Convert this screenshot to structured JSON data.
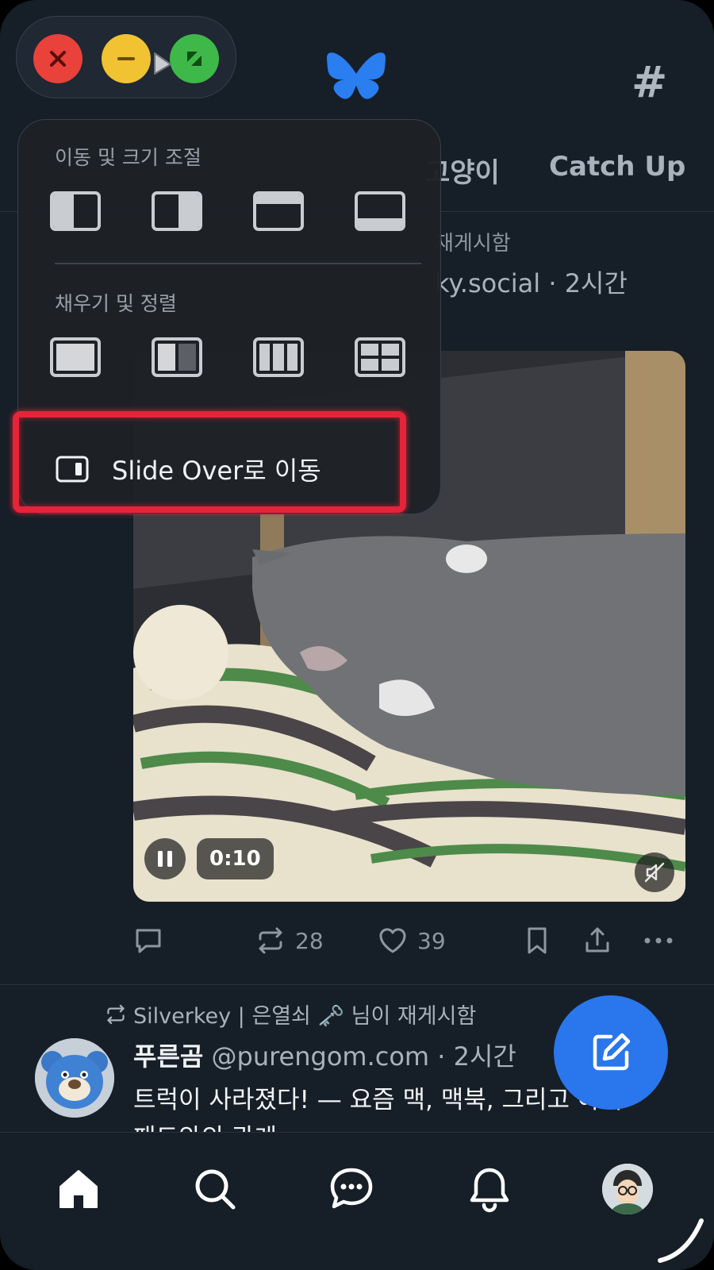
{
  "header": {
    "hash_label": "#",
    "tabs": [
      {
        "label": "고양이"
      },
      {
        "label": "Catch Up"
      }
    ]
  },
  "post1": {
    "repost_text_fragment": "재게시함",
    "author_fragment": "ky.social · 2시간",
    "video": {
      "time": "0:10",
      "playing": true,
      "muted": true
    },
    "actions": {
      "repost_count": "28",
      "like_count": "39"
    }
  },
  "post2": {
    "repost_by": "Silverkey | 은열쇠 🗝️ 님이 재게시함",
    "display_name": "푸른곰",
    "handle": "@purengom.com",
    "time": "· 2시간",
    "text": "트럭이 사라졌다! — 요즘 맥, 맥북, 그리고 아이",
    "text_line2": "패드와의 관계"
  },
  "window_menu": {
    "section_move_resize": "이동 및 크기 조절",
    "section_fill_arrange": "채우기 및 정렬",
    "slide_over_label": "Slide Over로 이동"
  },
  "colors": {
    "background": "#161e27",
    "accent": "#2a76ec",
    "highlight": "#e5243a"
  },
  "bottom_nav": {
    "items": [
      "home-icon",
      "search-icon",
      "chat-icon",
      "bell-icon",
      "profile-avatar"
    ]
  }
}
